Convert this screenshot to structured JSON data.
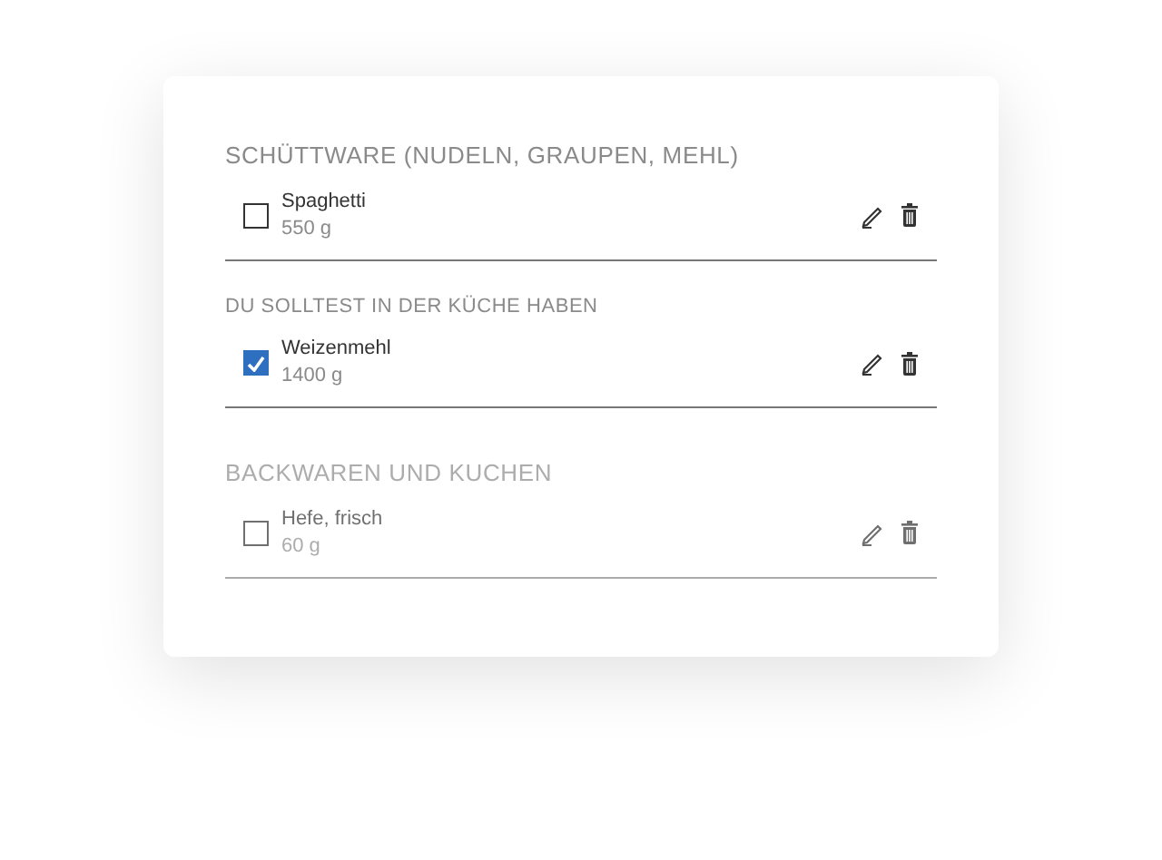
{
  "sections": [
    {
      "kind": "category",
      "title": "SCHÜTTWARE (NUDELN, GRAUPEN, MEHL)",
      "dimmed": false,
      "items": [
        {
          "name": "Spaghetti",
          "amount": "550 g",
          "checked": false
        }
      ]
    },
    {
      "kind": "hint",
      "title": "DU SOLLTEST IN DER KÜCHE HABEN",
      "dimmed": false,
      "items": [
        {
          "name": "Weizenmehl",
          "amount": "1400 g",
          "checked": true
        }
      ]
    },
    {
      "kind": "category",
      "title": "BACKWAREN UND KUCHEN",
      "dimmed": true,
      "items": [
        {
          "name": "Hefe, frisch",
          "amount": "60 g",
          "checked": false
        }
      ]
    }
  ]
}
